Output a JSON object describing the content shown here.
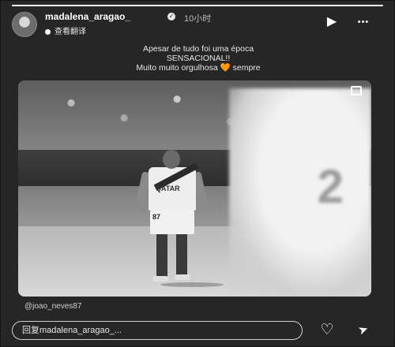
{
  "story": {
    "progress": 1.0
  },
  "header": {
    "username": "madalena_aragao_",
    "verified": "✓",
    "time": "10小时",
    "translate": "查看翻译",
    "play_icon": "▶",
    "more_icon": "•••"
  },
  "caption": {
    "line1": "Apesar de tudo foi uma época",
    "line2": "SENSACIONAL!!",
    "line3_pre": "Muito muito orgulhosa ",
    "heart_emoji": "🧡",
    "line3_post": " sempre"
  },
  "photo": {
    "sponsor": "QATAR",
    "jersey_number": "87",
    "background_number": "2"
  },
  "mention": "@joao_neves87",
  "footer": {
    "reply_placeholder": "回复madalena_aragao_...",
    "like_icon": "♡",
    "send_icon": "➤"
  },
  "colors": {
    "background": "#262626",
    "text": "#ffffff",
    "heart": "#e8a23b"
  }
}
